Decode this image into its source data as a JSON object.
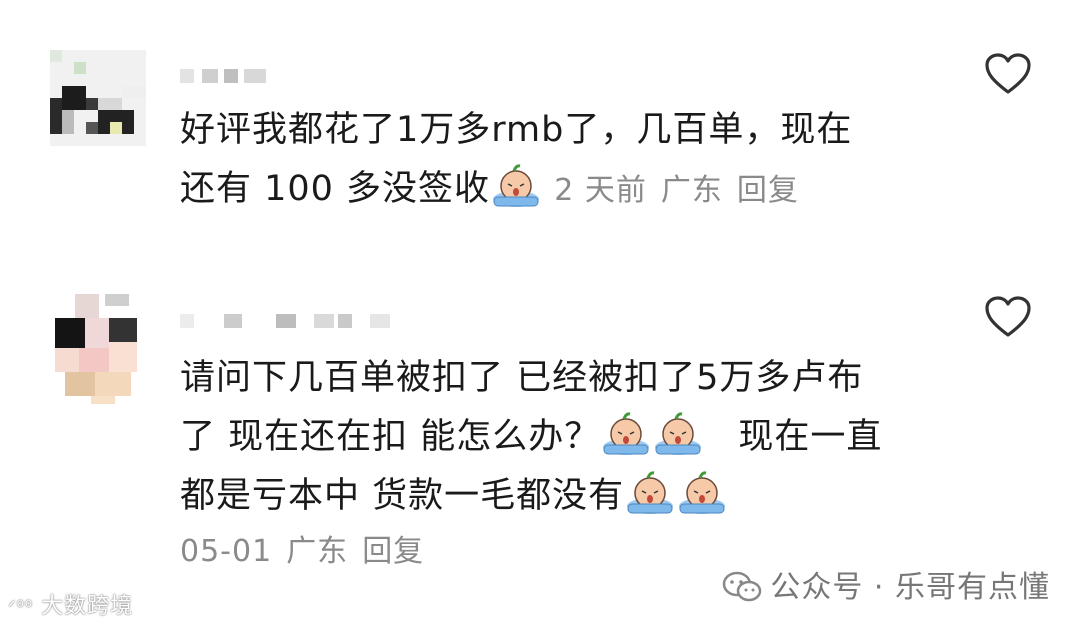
{
  "comments": [
    {
      "text_line1": "好评我都花了1万多rmb了，几百单，现在",
      "text_line2": "还有 100 多没签收",
      "date": "2 天前",
      "region": "广东",
      "reply": "回复"
    },
    {
      "text_line1": "请问下几百单被扣了  已经被扣了5万多卢布",
      "text_line2a": "了  现在还在扣  能怎么办？",
      "text_line2b": "现在一直",
      "text_line3": "都是亏本中  货款一毛都没有",
      "date": "05-01",
      "region": "广东",
      "reply": "回复"
    }
  ],
  "watermark_left": "大数跨境",
  "watermark_right": "公众号 · 乐哥有点懂",
  "colors": {
    "text": "#1a1a1a",
    "meta": "#8a8a8a",
    "heart": "#333333"
  },
  "icons": [
    "heart-outline-icon",
    "crying-emoji-icon",
    "wechat-icon"
  ]
}
